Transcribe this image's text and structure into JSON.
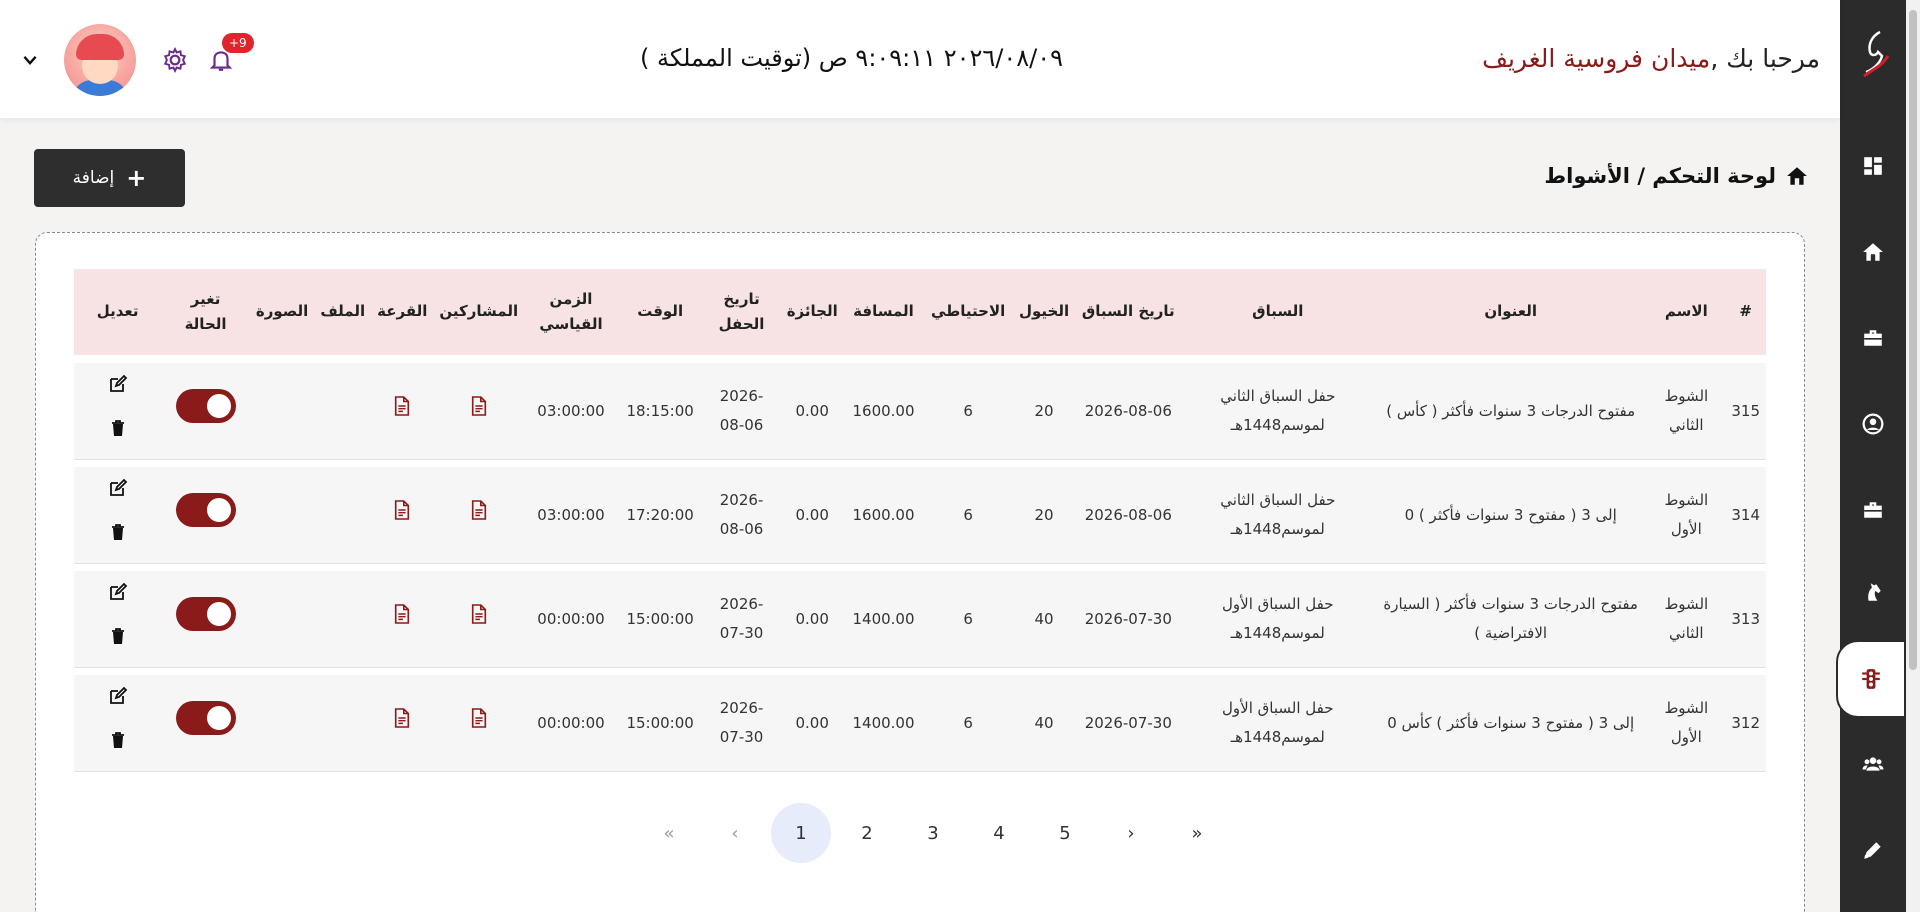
{
  "header": {
    "welcome_prefix": "مرحبا بك ,",
    "place_name": "ميدان فروسية الغريف",
    "clock": "٢٠٢٦/٠٨/٠٩ ٩:٠٩:١١ ص (توقيت المملكة )",
    "notifications_badge": "+9"
  },
  "breadcrumb": "لوحة التحكم / الأشواط",
  "add_button": "إضافة",
  "table": {
    "headers": [
      "#",
      "الاسم",
      "العنوان",
      "السباق",
      "تاريخ السباق",
      "الخيول",
      "الاحتياطي",
      "المسافة",
      "الجائزة",
      "تاريخ الحفل",
      "الوقت",
      "الزمن القياسي",
      "المشاركين",
      "القرعة",
      "الملف",
      "الصورة",
      "تغير الحالة",
      "تعديل"
    ],
    "rows": [
      {
        "id": "315",
        "name": "الشوط الثاني",
        "title": "مفتوح الدرجات 3 سنوات فأكثر ( كأس )",
        "race": "حفل السباق الثاني لموسم1448هـ",
        "race_date": "2026-08-06",
        "horses": "20",
        "reserve": "6",
        "distance": "1600.00",
        "prize": "0.00",
        "party_date": "2026-08-06",
        "time": "18:15:00",
        "record": "03:00:00",
        "active": true
      },
      {
        "id": "314",
        "name": "الشوط الأول",
        "title": "إلى 3 ( مفتوح 3 سنوات فأكثر ) 0",
        "race": "حفل السباق الثاني لموسم1448هـ",
        "race_date": "2026-08-06",
        "horses": "20",
        "reserve": "6",
        "distance": "1600.00",
        "prize": "0.00",
        "party_date": "2026-08-06",
        "time": "17:20:00",
        "record": "03:00:00",
        "active": true
      },
      {
        "id": "313",
        "name": "الشوط الثاني",
        "title": "مفتوح الدرجات 3 سنوات فأكثر ( السيارة الافتراضية )",
        "race": "حفل السباق الأول لموسم1448هـ",
        "race_date": "2026-07-30",
        "horses": "40",
        "reserve": "6",
        "distance": "1400.00",
        "prize": "0.00",
        "party_date": "2026-07-30",
        "time": "15:00:00",
        "record": "00:00:00",
        "active": true
      },
      {
        "id": "312",
        "name": "الشوط الأول",
        "title": "إلى 3 ( مفتوح 3 سنوات فأكثر ) كأس 0",
        "race": "حفل السباق الأول لموسم1448هـ",
        "race_date": "2026-07-30",
        "horses": "40",
        "reserve": "6",
        "distance": "1400.00",
        "prize": "0.00",
        "party_date": "2026-07-30",
        "time": "15:00:00",
        "record": "00:00:00",
        "active": true
      }
    ]
  },
  "pagination": {
    "first": "«",
    "prev": "‹",
    "pages": [
      "1",
      "2",
      "3",
      "4",
      "5"
    ],
    "current": "1",
    "next": "›",
    "last": "»"
  },
  "colors": {
    "accent": "#8b1a1a",
    "sidebar": "#2b2b2b",
    "header_row": "#f7e3e3"
  },
  "sidebar_icons": [
    "horse-logo-icon",
    "dashboard-icon",
    "home-icon",
    "briefcase-icon",
    "user-circle-icon",
    "briefcase-icon",
    "horse-head-icon",
    "traffic-light-icon",
    "users-icon",
    "pen-icon"
  ]
}
